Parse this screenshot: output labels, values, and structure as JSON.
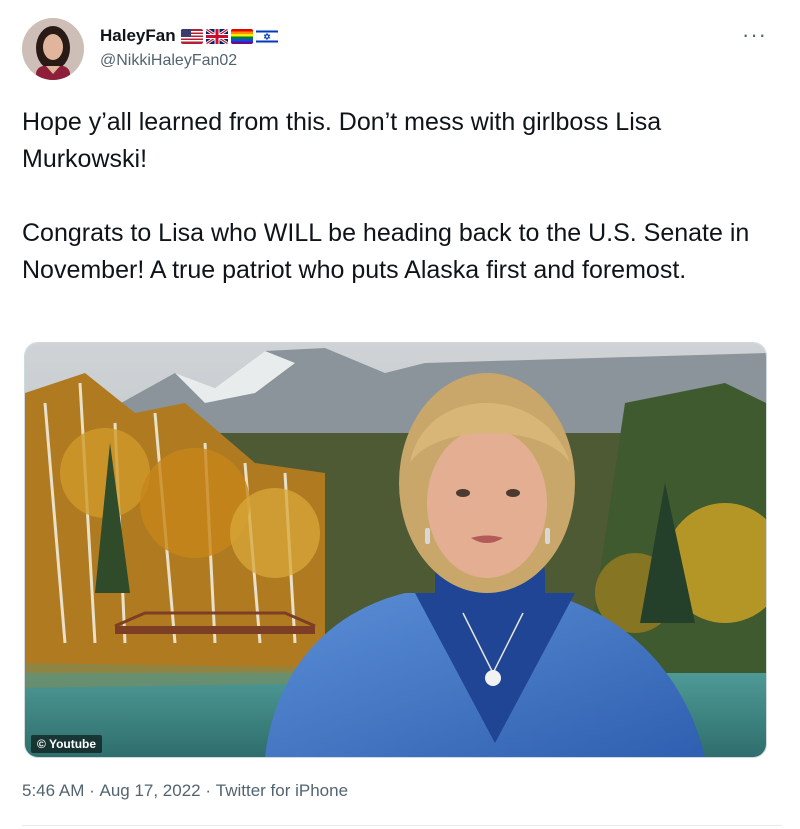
{
  "tweet": {
    "display_name": "HaleyFan",
    "handle": "@NikkiHaleyFan02",
    "more_label": "···",
    "flags": [
      "us-flag",
      "uk-flag",
      "rainbow-flag",
      "israel-flag"
    ],
    "paragraphs": [
      "Hope y’all learned from this. Don’t mess with girlboss Lisa Murkowski!",
      "Congrats to Lisa who WILL be heading back to the U.S. Senate in November! A true patriot who puts Alaska first and foremost."
    ],
    "media": {
      "watermark": "© Youtube"
    },
    "time": "5:46 AM",
    "separator": " · ",
    "date": "Aug 17, 2022",
    "source": "Twitter for iPhone"
  }
}
